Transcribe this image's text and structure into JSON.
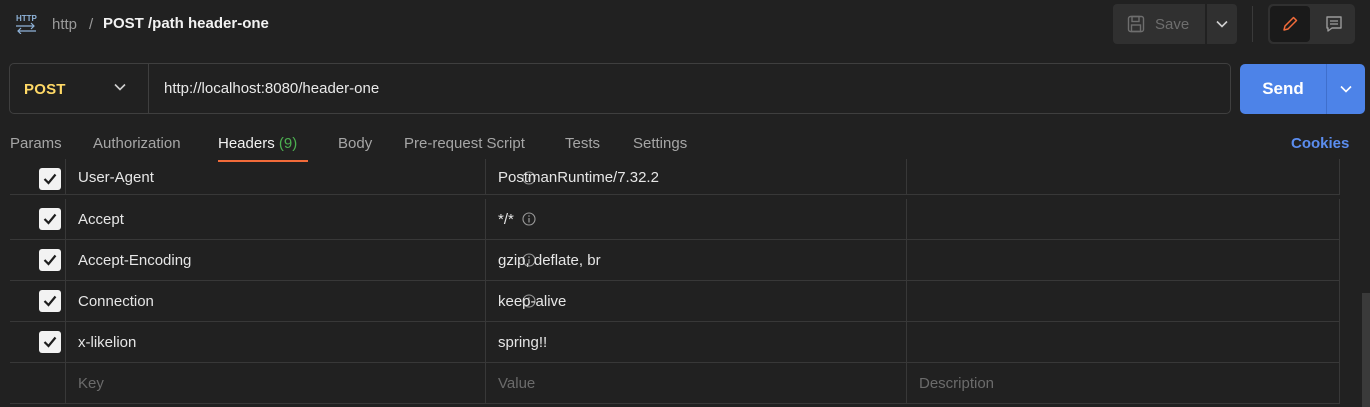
{
  "breadcrumb": {
    "icon": "http-icon",
    "parent": "http",
    "separator": "/",
    "title": "POST /path header-one"
  },
  "toolbar": {
    "save_label": "Save",
    "icons": [
      "save-icon",
      "chevron-down-icon",
      "pencil-icon",
      "comment-icon"
    ]
  },
  "request": {
    "method": "POST",
    "url": "http://localhost:8080/header-one",
    "send_label": "Send"
  },
  "tabs": [
    {
      "label": "Params",
      "count": ""
    },
    {
      "label": "Authorization",
      "count": ""
    },
    {
      "label": "Headers",
      "count": "(9)",
      "active": true
    },
    {
      "label": "Body",
      "count": ""
    },
    {
      "label": "Pre-request Script",
      "count": ""
    },
    {
      "label": "Tests",
      "count": ""
    },
    {
      "label": "Settings",
      "count": ""
    }
  ],
  "cookies_label": "Cookies",
  "headers": {
    "rows": [
      {
        "checked": true,
        "key": "User-Agent",
        "info": true,
        "value": "PostmanRuntime/7.32.2",
        "description": ""
      },
      {
        "checked": true,
        "key": "Accept",
        "info": true,
        "value": "*/*",
        "description": ""
      },
      {
        "checked": true,
        "key": "Accept-Encoding",
        "info": true,
        "value": "gzip, deflate, br",
        "description": ""
      },
      {
        "checked": true,
        "key": "Connection",
        "info": true,
        "value": "keep-alive",
        "description": ""
      },
      {
        "checked": true,
        "key": "x-likelion",
        "info": false,
        "value": "spring!!",
        "description": ""
      }
    ],
    "new_row": {
      "key_placeholder": "Key",
      "value_placeholder": "Value",
      "description_placeholder": "Description"
    }
  },
  "colors": {
    "background": "#212121",
    "method": "#ffd966",
    "send": "#4d83e8",
    "active_tab_underline": "#f26b3a",
    "count": "#4caf50",
    "cookies": "#5b8def"
  }
}
